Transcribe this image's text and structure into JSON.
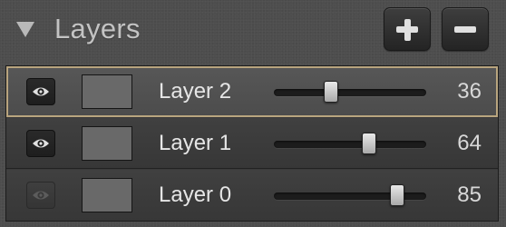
{
  "panel": {
    "title": "Layers",
    "expanded": true,
    "add_button_icon": "plus-icon",
    "remove_button_icon": "minus-icon"
  },
  "layers": [
    {
      "name": "Layer 2",
      "opacity": 36,
      "visible": true,
      "selected": true
    },
    {
      "name": "Layer 1",
      "opacity": 64,
      "visible": true,
      "selected": false
    },
    {
      "name": "Layer 0",
      "opacity": 85,
      "visible": false,
      "selected": false
    }
  ],
  "colors": {
    "selection_outline": "#b9a57f",
    "panel_background": "#4d4d4d",
    "row_background": "#3a3a3a"
  }
}
